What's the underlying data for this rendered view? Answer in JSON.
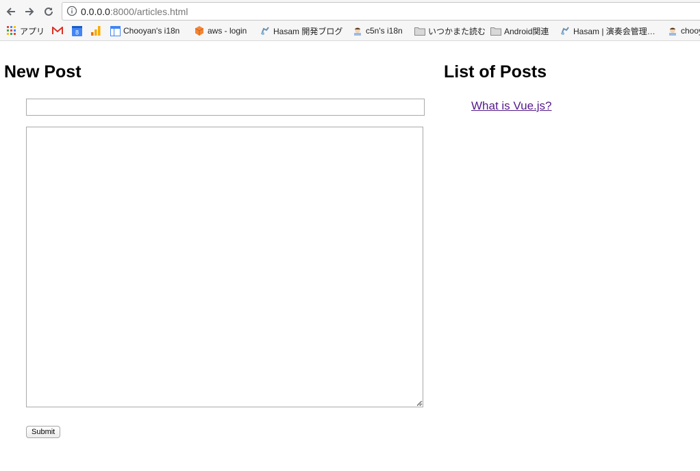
{
  "browser": {
    "url_host": "0.0.0.0",
    "url_path": ":8000/articles.html",
    "bookmarks": [
      {
        "label": "アプリ",
        "icon": "apps-grid-icon"
      },
      {
        "label": "",
        "icon": "gmail-icon"
      },
      {
        "label": "",
        "icon": "calendar-icon"
      },
      {
        "label": "",
        "icon": "analytics-icon"
      },
      {
        "label": "Chooyan's i18n",
        "icon": "page-layout-icon"
      },
      {
        "label": "aws - login",
        "icon": "aws-cube-icon"
      },
      {
        "label": "Hasam 開発ブログ",
        "icon": "blog-icon"
      },
      {
        "label": "c5n's i18n",
        "icon": "avatar-icon"
      },
      {
        "label": "いつかまた読む",
        "icon": "folder-icon"
      },
      {
        "label": "Android関連",
        "icon": "folder-icon"
      },
      {
        "label": "Hasam | 演奏会管理…",
        "icon": "blog-icon"
      },
      {
        "label": "chooy",
        "icon": "avatar-icon"
      }
    ]
  },
  "new_post": {
    "heading": "New Post",
    "title_value": "",
    "body_value": "",
    "submit_label": "Submit"
  },
  "posts": {
    "heading": "List of Posts",
    "items": [
      {
        "title": "What is Vue.js?"
      }
    ]
  },
  "colors": {
    "link_visited": "#551a8b",
    "input_border": "#a9a9a9"
  }
}
